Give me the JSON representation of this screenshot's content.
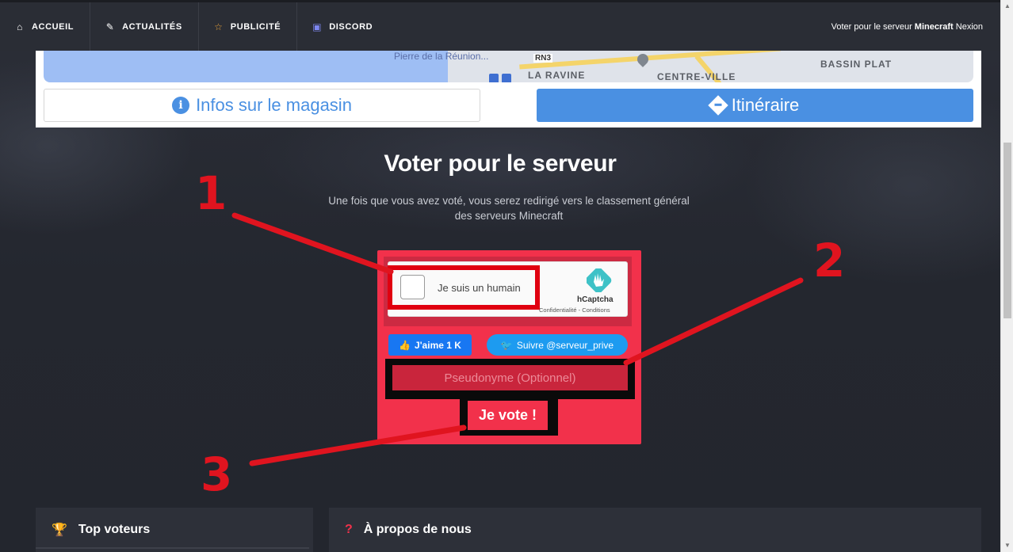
{
  "nav": {
    "items": [
      {
        "label": "ACCUEIL",
        "icon": "home-icon"
      },
      {
        "label": "ACTUALITÉS",
        "icon": "pencil-icon"
      },
      {
        "label": "PUBLICITÉ",
        "icon": "star-icon"
      },
      {
        "label": "DISCORD",
        "icon": "discord-icon"
      }
    ],
    "right_prefix": "Voter pour le serveur ",
    "right_bold": "Minecraft",
    "right_suffix": " Nexion"
  },
  "map": {
    "labels": {
      "bureau": "Bureau Vallée Saint-\nPierre de la Réunion...",
      "rn3": "RN3",
      "la_ravine": "LA RAVINE",
      "centre_ville": "CENTRE-VILLE",
      "bassin_plat": "BASSIN PLAT"
    },
    "info_button": "Infos sur le magasin",
    "route_button": "Itinéraire",
    "colors": {
      "accent": "#4a90e2"
    }
  },
  "vote": {
    "title": "Voter pour le serveur",
    "subtitle": "Une fois que vous avez voté, vous serez redirigé vers le classement général des serveurs Minecraft",
    "captcha": {
      "label": "Je suis un humain",
      "brand": "hCaptcha",
      "links": "Confidentialité - Conditions"
    },
    "facebook_button": "J'aime 1 K",
    "twitter_button": "Suivre @serveur_prive",
    "pseudo_placeholder": "Pseudonyme (Optionnel)",
    "submit": "Je vote !",
    "colors": {
      "card": "#f2314b"
    }
  },
  "annotations": [
    "1",
    "2",
    "3"
  ],
  "panels": {
    "top_voters": "Top voteurs",
    "about": "À propos de nous"
  }
}
